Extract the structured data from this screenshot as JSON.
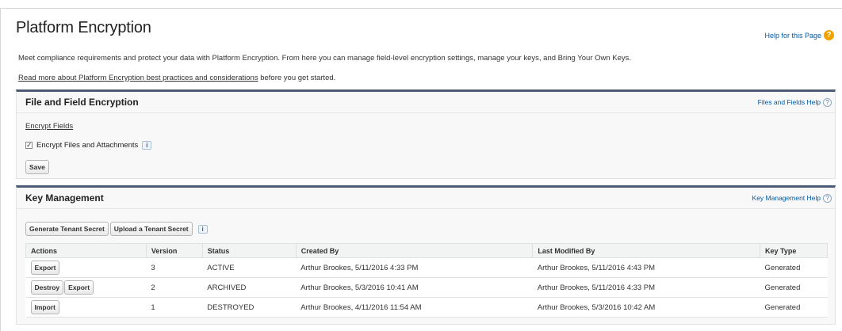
{
  "page": {
    "title": "Platform Encryption",
    "help_link": "Help for this Page",
    "intro": "Meet compliance requirements and protect your data with Platform Encryption. From here you can manage field-level encryption settings, manage your keys, and Bring Your Own Keys.",
    "readmore_link": "Read more about Platform Encryption best practices and considerations",
    "readmore_suffix": " before you get started."
  },
  "file_field": {
    "title": "File and Field Encryption",
    "help": "Files and Fields Help",
    "encrypt_fields_link": "Encrypt Fields",
    "checkbox_label": "Encrypt Files and Attachments",
    "checkbox_checked": true,
    "save_label": "Save"
  },
  "key_management": {
    "title": "Key Management",
    "help": "Key Management Help",
    "generate_label": "Generate Tenant Secret",
    "upload_label": "Upload a Tenant Secret",
    "columns": [
      "Actions",
      "Version",
      "Status",
      "Created By",
      "Last Modified By",
      "Key Type"
    ],
    "rows": [
      {
        "actions": [
          "Export"
        ],
        "version": "3",
        "status": "ACTIVE",
        "created_by": "Arthur Brookes, 5/11/2016 4:33 PM",
        "modified_by": "Arthur Brookes, 5/11/2016 4:43 PM",
        "key_type": "Generated"
      },
      {
        "actions": [
          "Destroy",
          "Export"
        ],
        "version": "2",
        "status": "ARCHIVED",
        "created_by": "Arthur Brookes, 5/3/2016 10:41 AM",
        "modified_by": "Arthur Brookes, 5/11/2016 4:33 PM",
        "key_type": "Generated"
      },
      {
        "actions": [
          "Import"
        ],
        "version": "1",
        "status": "DESTROYED",
        "created_by": "Arthur Brookes, 4/11/2016 11:54 AM",
        "modified_by": "Arthur Brookes, 5/3/2016 10:42 AM",
        "key_type": "Generated"
      }
    ]
  },
  "icons": {
    "help_page": "question-circle-icon",
    "section_help": "help-circle-icon",
    "info": "info-icon",
    "checkbox": "checkbox-checked-icon"
  },
  "colors": {
    "link": "#015ba7",
    "section_accent": "#4b5b78",
    "help_orange": "#f2a200"
  }
}
